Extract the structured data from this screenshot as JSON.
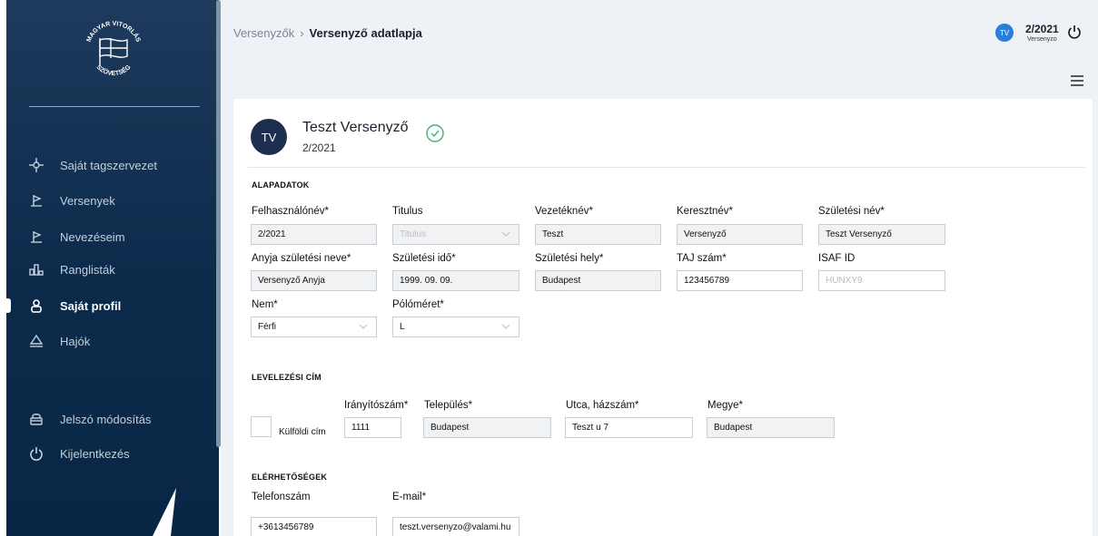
{
  "sidebar": {
    "logo_text_top": "MAGYAR VITORLÁS",
    "logo_text_bottom": "SZÖVETSÉG",
    "items": [
      {
        "label": "Saját tagszervezet",
        "icon": "crosshair-icon"
      },
      {
        "label": "Versenyek",
        "icon": "flag-icon"
      },
      {
        "label": "Nevezéseim",
        "icon": "flag-icon"
      },
      {
        "label": "Ranglisták",
        "icon": "podium-icon"
      },
      {
        "label": "Saját profil",
        "icon": "person-icon",
        "active": true
      },
      {
        "label": "Hajók",
        "icon": "boat-icon"
      },
      {
        "label": "Jelszó módosítás",
        "icon": "lock-icon"
      },
      {
        "label": "Kijelentkezés",
        "icon": "power-icon"
      }
    ]
  },
  "header": {
    "breadcrumb_parent": "Versenyzők",
    "breadcrumb_separator": "›",
    "breadcrumb_current": "Versenyző adatlapja",
    "user_initials": "TV",
    "user_id": "2/2021",
    "user_role": "Versenyzo"
  },
  "profile": {
    "initials": "TV",
    "name": "Teszt Versenyző",
    "id": "2/2021"
  },
  "basic": {
    "title": "ALAPADATOK",
    "username_label": "Felhasználónév*",
    "username": "2/2021",
    "titulus_label": "Titulus",
    "titulus_placeholder": "Titulus",
    "lastname_label": "Vezetéknév*",
    "lastname": "Teszt",
    "firstname_label": "Keresztnév*",
    "firstname": "Versenyző",
    "birthname_label": "Születési név*",
    "birthname": "Teszt Versenyző",
    "mothername_label": "Anyja születési neve*",
    "mothername": "Versenyző Anyja",
    "birthdate_label": "Születési idő*",
    "birthdate": "1999. 09. 09.",
    "birthplace_label": "Születési hely*",
    "birthplace": "Budapest",
    "taj_label": "TAJ szám*",
    "taj": "123456789",
    "isaf_label": "ISAF ID",
    "isaf_placeholder": "HUNXY9",
    "gender_label": "Nem*",
    "gender": "Férfi",
    "shirt_label": "Pólóméret*",
    "shirt": "L"
  },
  "address": {
    "title": "LEVELEZÉSI CÍM",
    "foreign_label": "Külföldi cím",
    "zip_label": "Irányítószám*",
    "zip": "1111",
    "city_label": "Település*",
    "city": "Budapest",
    "street_label": "Utca, házszám*",
    "street": "Teszt u 7",
    "county_label": "Megye*",
    "county": "Budapest"
  },
  "contacts": {
    "title": "ELÉRHETŐSÉGEK",
    "phone_label": "Telefonszám",
    "phone": "+3613456789",
    "email_label": "E-mail*",
    "email": "teszt.versenyzo@valami.hu"
  },
  "colors": {
    "sidebar": "#0b2a4a",
    "accent": "#2a7ed8",
    "success": "#3cb371",
    "avatar": "#1d2e4f"
  }
}
